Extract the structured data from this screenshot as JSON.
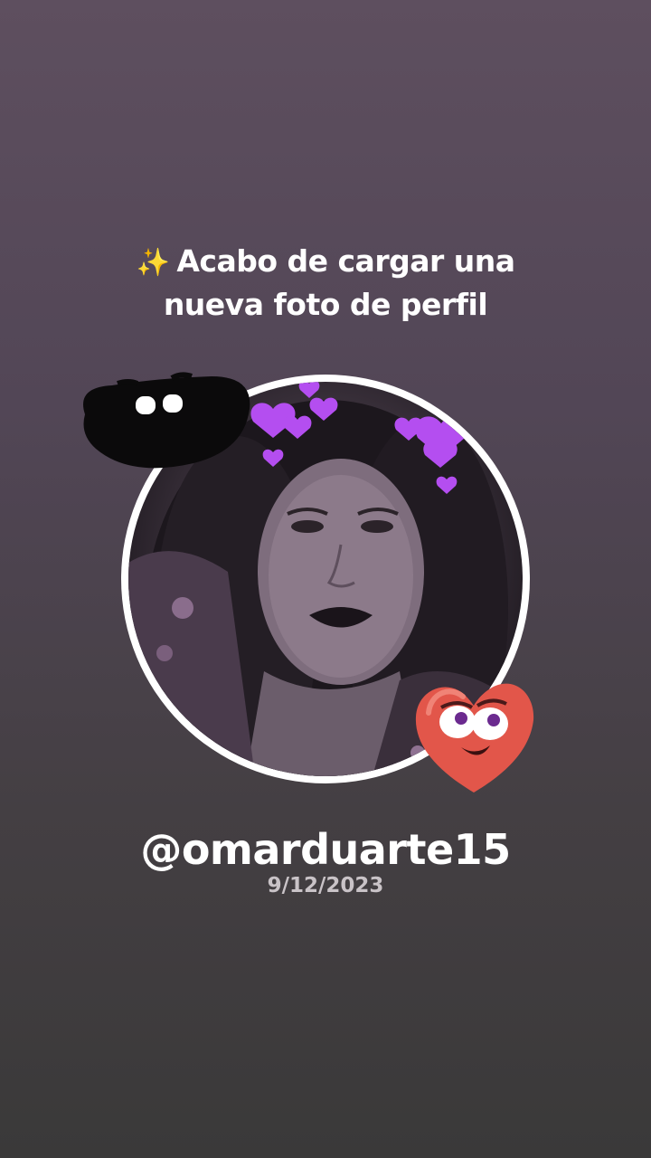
{
  "headline": {
    "sparkle_icon": "✨",
    "line1": "Acabo de cargar una",
    "line2": "nueva foto de perfil"
  },
  "profile": {
    "photo_icon": "profile-photo",
    "sticker_left": "black-blob-face-sticker",
    "sticker_right": "red-heart-face-sticker",
    "heart_color": "#e2564a",
    "accent_hearts_color": "#b44ef0"
  },
  "user": {
    "username": "@omarduarte15",
    "date": "9/12/2023"
  }
}
